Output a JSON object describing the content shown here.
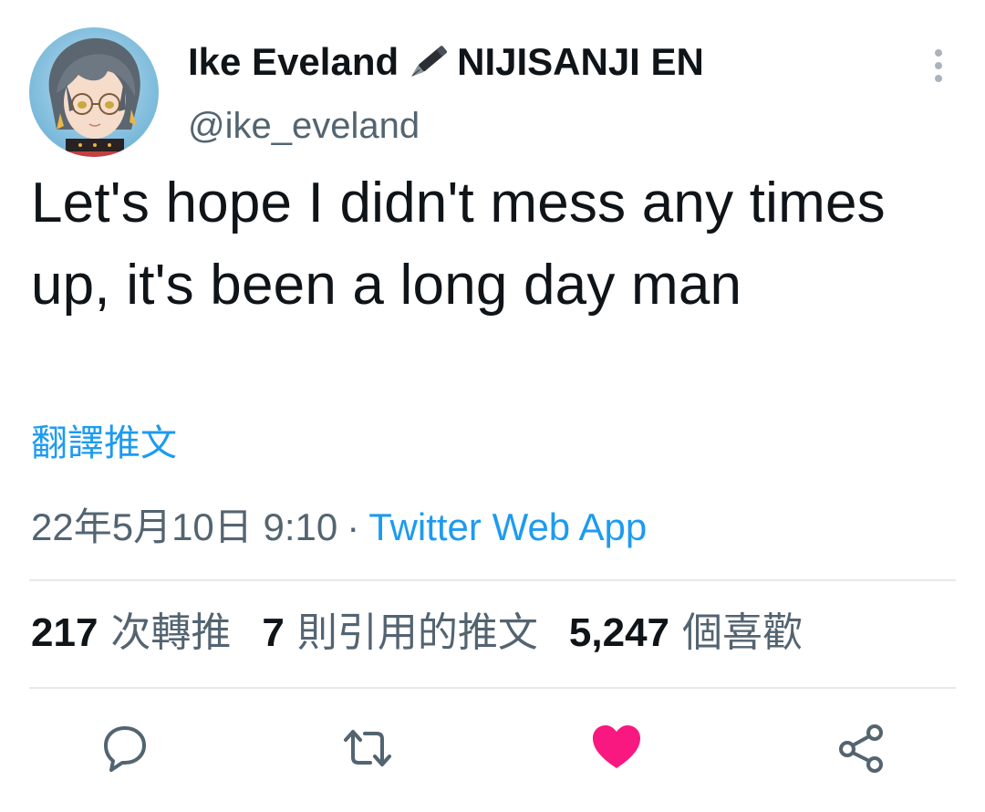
{
  "author": {
    "display_name": "Ike Eveland",
    "display_name_suffix": "NIJISANJI EN",
    "handle": "@ike_eveland",
    "avatar_icon": "anime-avatar-icon",
    "name_emoji": "fountain-pen-icon"
  },
  "tweet": {
    "text": "Let's hope I didn't mess any times up, it's been a long day man",
    "translate_label": "翻譯推文",
    "timestamp": "22年5月10日 9:10",
    "separator": "·",
    "source": "Twitter Web App"
  },
  "stats": {
    "retweets": {
      "count": "217",
      "label": "次轉推"
    },
    "quotes": {
      "count": "7",
      "label": "則引用的推文"
    },
    "likes": {
      "count": "5,247",
      "label": "個喜歡"
    }
  },
  "actions": {
    "reply": "reply-icon",
    "retweet": "retweet-icon",
    "like": "heart-filled-icon",
    "share": "share-icon",
    "more": "more-vertical-icon"
  },
  "colors": {
    "text": "#0f1419",
    "secondary": "#536471",
    "link": "#1d9bf0",
    "like": "#f91880",
    "divider": "#e6e9ec"
  }
}
